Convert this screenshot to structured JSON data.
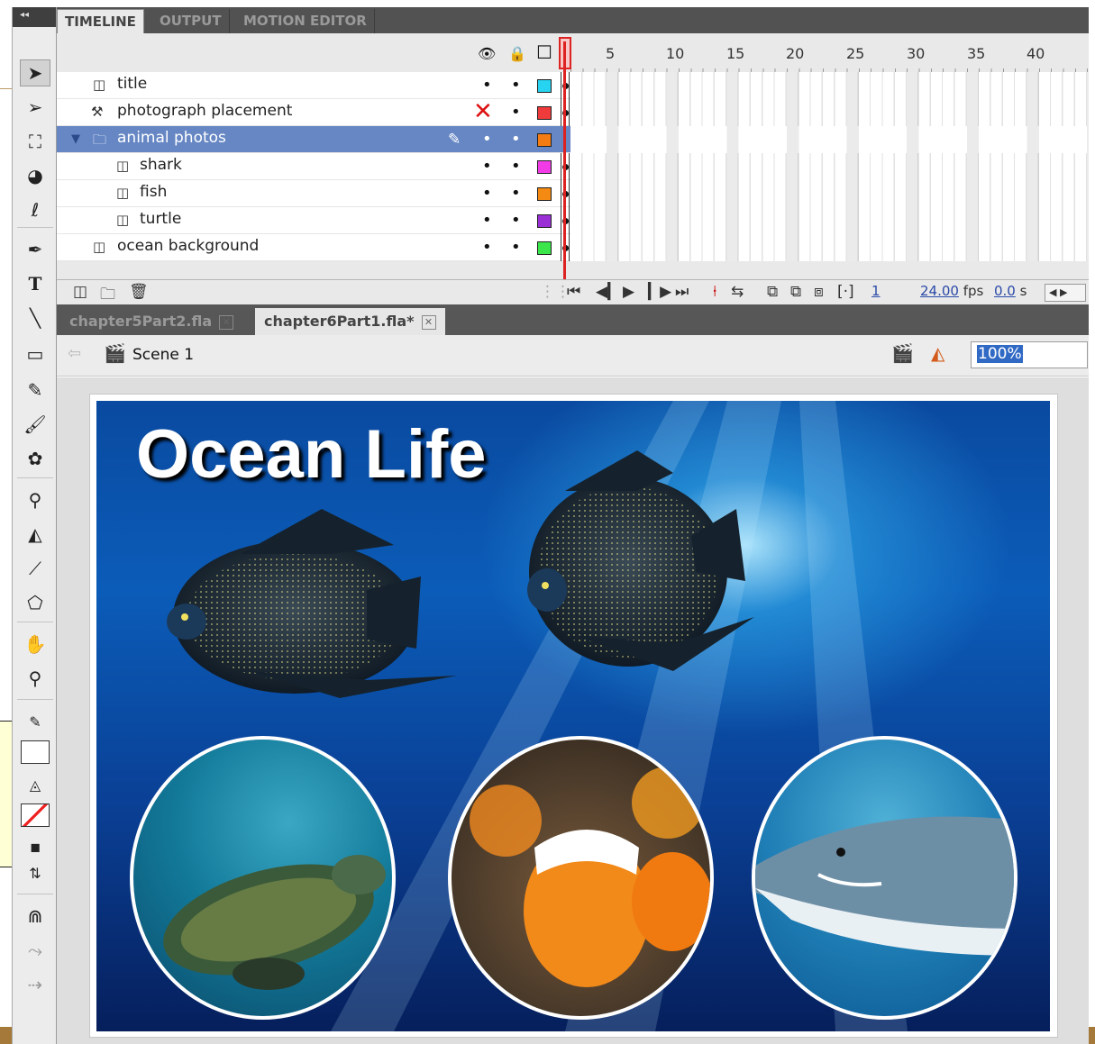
{
  "timeline_tabs": [
    "TIMELINE",
    "OUTPUT",
    "MOTION EDITOR"
  ],
  "frame_ruler": [
    "5",
    "10",
    "15",
    "20",
    "25",
    "30",
    "35",
    "40"
  ],
  "layers": [
    {
      "name": "title",
      "color": "#26d3f0",
      "visible_mark": "•",
      "lock_mark": "•"
    },
    {
      "name": "photograph placement",
      "color": "#ef3b3b",
      "visible_mark": "✕",
      "lock_mark": "•"
    },
    {
      "name": "animal photos",
      "color": "#f57c12",
      "visible_mark": "•",
      "lock_mark": "•",
      "selected": true,
      "type": "folder"
    },
    {
      "name": "shark",
      "color": "#f03be6",
      "visible_mark": "•",
      "lock_mark": "•"
    },
    {
      "name": "fish",
      "color": "#f58a12",
      "visible_mark": "•",
      "lock_mark": "•"
    },
    {
      "name": "turtle",
      "color": "#9b2fd6",
      "visible_mark": "•",
      "lock_mark": "•"
    },
    {
      "name": "ocean background",
      "color": "#3be64a",
      "visible_mark": "•",
      "lock_mark": "•"
    }
  ],
  "status": {
    "current_frame": "1",
    "frame_rate": "24.00",
    "frame_rate_unit": "fps",
    "elapsed": "0.0",
    "elapsed_unit": "s"
  },
  "documents": [
    {
      "label": "chapter5Part2.fla",
      "active": false
    },
    {
      "label": "chapter6Part1.fla*",
      "active": true
    }
  ],
  "editbar": {
    "scene": "Scene 1",
    "zoom": "100%"
  },
  "stage": {
    "title": "Ocean Life"
  },
  "icons": {
    "tools": [
      "selection-icon",
      "subselection-icon",
      "free-transform-icon",
      "3d-rotation-icon",
      "lasso-icon",
      "pen-icon",
      "text-icon",
      "line-icon",
      "rectangle-icon",
      "pencil-icon",
      "brush-icon",
      "deco-icon",
      "bone-icon",
      "paint-bucket-icon",
      "eyedropper-icon",
      "eraser-icon",
      "hand-icon",
      "zoom-icon",
      "stroke-color-icon",
      "fill-color-icon",
      "swap-colors-icon",
      "snap-magnet-icon",
      "smooth-icon",
      "straighten-icon"
    ]
  }
}
